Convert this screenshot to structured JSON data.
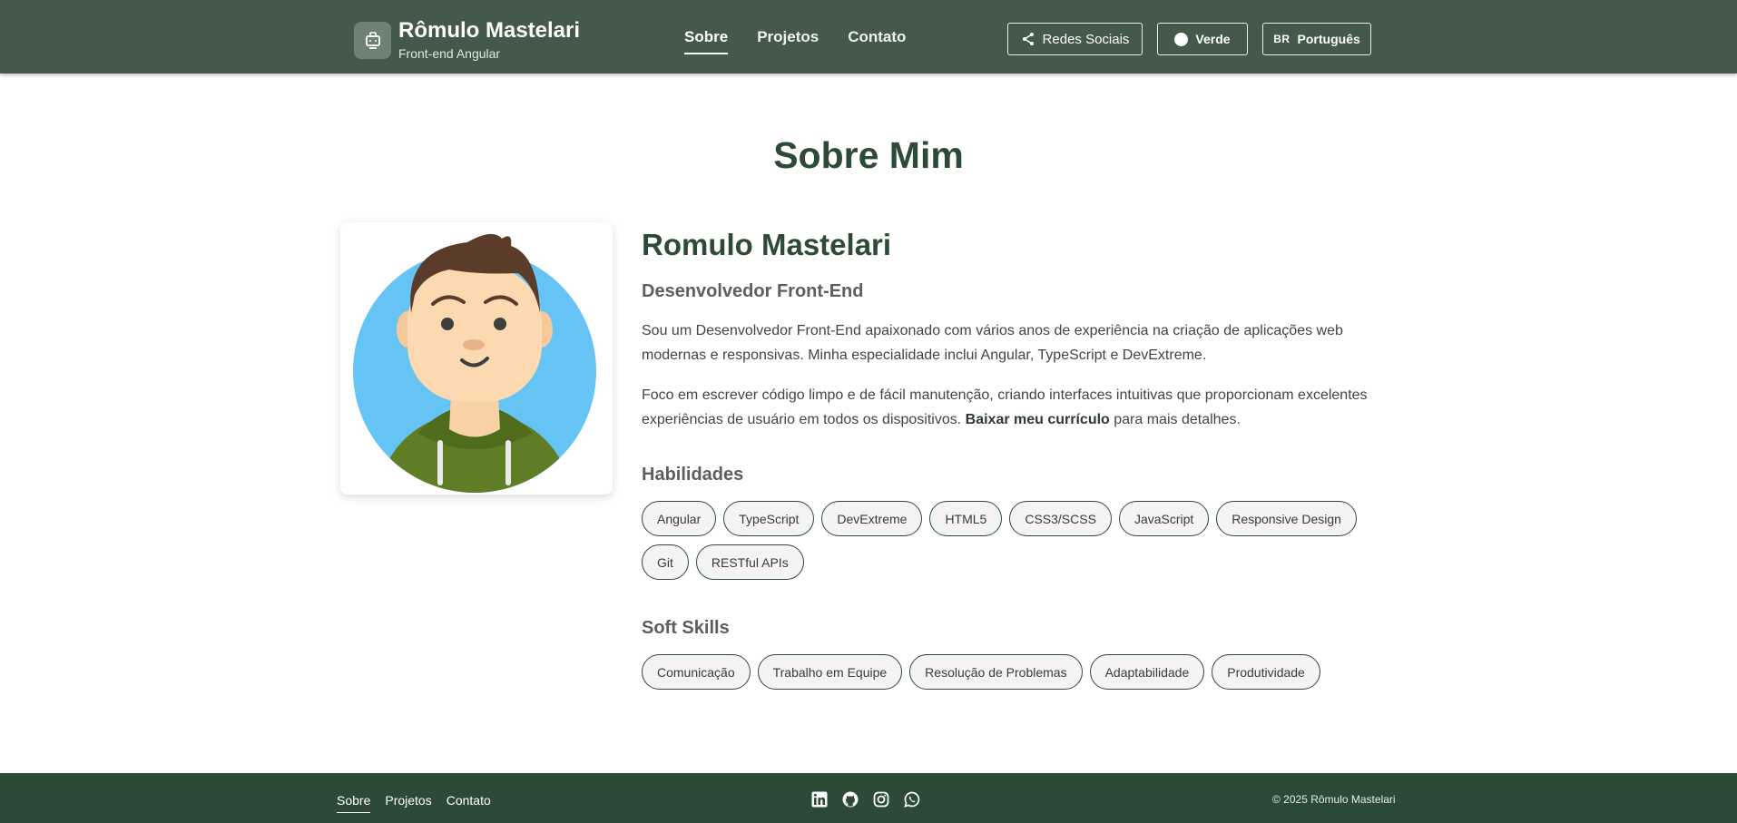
{
  "header": {
    "brand_name": "Rômulo Mastelari",
    "brand_subtitle": "Front-end Angular",
    "nav": [
      {
        "label": "Sobre",
        "active": true
      },
      {
        "label": "Projetos",
        "active": false
      },
      {
        "label": "Contato",
        "active": false
      }
    ],
    "social_button": {
      "label": "Redes Sociais",
      "icon": "share-icon"
    },
    "theme_button": {
      "label": "Verde",
      "icon": "circle-icon"
    },
    "language_button": {
      "flag": "BR",
      "label": "Português"
    }
  },
  "main": {
    "section_title": "Sobre Mim",
    "name": "Romulo Mastelari",
    "role": "Desenvolvedor Front-End",
    "paragraph1": "Sou um Desenvolvedor Front-End apaixonado com vários anos de experiência na criação de aplicações web modernas e responsivas. Minha especialidade inclui Angular, TypeScript e DevExtreme.",
    "paragraph2_start": "Foco em escrever código limpo e de fácil manutenção, criando interfaces intuitivas que proporcionam excelentes experiências de usuário em todos os dispositivos. ",
    "resume_link": "Baixar meu currículo",
    "paragraph2_end": " para mais detalhes.",
    "skills_title": "Habilidades",
    "skills": [
      "Angular",
      "TypeScript",
      "DevExtreme",
      "HTML5",
      "CSS3/SCSS",
      "JavaScript",
      "Responsive Design",
      "Git",
      "RESTful APIs"
    ],
    "soft_skills_title": "Soft Skills",
    "soft_skills": [
      "Comunicação",
      "Trabalho em Equipe",
      "Resolução de Problemas",
      "Adaptabilidade",
      "Produtividade"
    ]
  },
  "footer": {
    "nav": [
      {
        "label": "Sobre",
        "active": true
      },
      {
        "label": "Projetos",
        "active": false
      },
      {
        "label": "Contato",
        "active": false
      }
    ],
    "social_icons": [
      "linkedin-icon",
      "github-icon",
      "instagram-icon",
      "whatsapp-icon"
    ],
    "copyright": "© 2025 Rômulo Mastelari"
  },
  "colors": {
    "header_bg": "#44594a",
    "footer_bg": "#2d4a36",
    "heading": "#2d4a36",
    "chip_border": "#2d4a36"
  }
}
